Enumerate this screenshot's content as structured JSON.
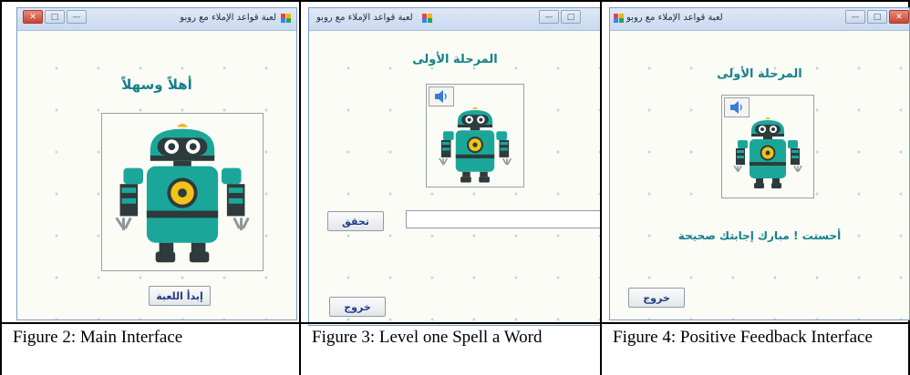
{
  "app": {
    "window_title": "لعبة قواعد الإملاء مع روبو",
    "minimize": "—",
    "maximize": "□",
    "close": "✕"
  },
  "figures": [
    {
      "heading": "أهلاً وسهلاً",
      "start_button": "إبدأ اللعبة",
      "caption": "Figure 2: Main Interface"
    },
    {
      "heading": "المرحلة الأولى",
      "check_button": "تحقق",
      "answer_value": "",
      "exit_button": "خروج",
      "caption": "Figure 3: Level one Spell a Word"
    },
    {
      "heading": "المرحلة الأولى",
      "feedback": "أحسنت ! مبارك إجابتك صحيحة",
      "exit_button": "خروج",
      "caption": "Figure 4: Positive Feedback Interface"
    }
  ],
  "colors": {
    "heading": "#157f8c",
    "robot_body": "#1aa79a",
    "robot_dark": "#2e3a3c",
    "button_text": "#1d3d86"
  },
  "icons": [
    "speaker-icon",
    "app-icon",
    "robot-image"
  ]
}
